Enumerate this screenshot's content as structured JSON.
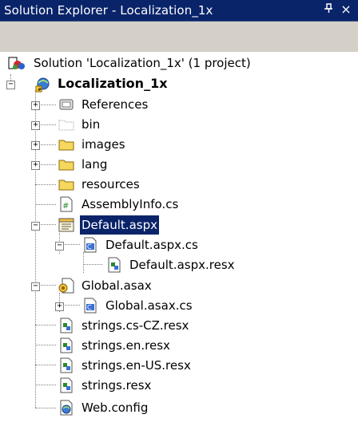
{
  "window": {
    "title": "Solution Explorer - Localization_1x",
    "pin_glyph": "ᵖ",
    "close_glyph": "×"
  },
  "tree": {
    "solution": "Solution 'Localization_1x' (1 project)",
    "project": "Localization_1x",
    "items": {
      "references": "References",
      "bin": "bin",
      "images": "images",
      "lang": "lang",
      "resources": "resources",
      "assemblyinfo": "AssemblyInfo.cs",
      "default_aspx": "Default.aspx",
      "default_cs": "Default.aspx.cs",
      "default_resx": "Default.aspx.resx",
      "global_asax": "Global.asax",
      "global_cs": "Global.asax.cs",
      "strings_cz": "strings.cs-CZ.resx",
      "strings_en": "strings.en.resx",
      "strings_en_us": "strings.en-US.resx",
      "strings": "strings.resx",
      "webconfig": "Web.config"
    },
    "selected_item": "Default.aspx"
  },
  "colors": {
    "titlebar": "#0a246a",
    "toolbar": "#d4d0c8",
    "selection": "#0a246a",
    "folder": "#f5d75c"
  }
}
